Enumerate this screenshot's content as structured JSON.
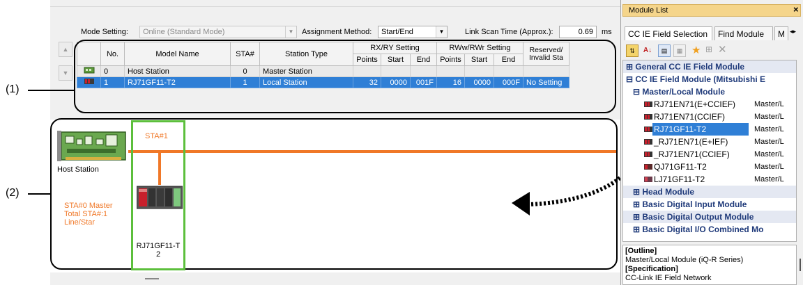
{
  "callouts": {
    "one": "(1)",
    "two": "(2)"
  },
  "toolbar": {
    "mode_label": "Mode Setting:",
    "mode_value": "Online (Standard Mode)",
    "assign_label": "Assignment Method:",
    "assign_value": "Start/End",
    "scan_label": "Link Scan Time (Approx.):",
    "scan_value": "0.69",
    "scan_unit": "ms"
  },
  "table": {
    "headers": {
      "no": "No.",
      "model": "Model Name",
      "sta": "STA#",
      "type": "Station Type",
      "rxry": "RX/RY Setting",
      "rwwr": "RWw/RWr Setting",
      "reserved": "Reserved/",
      "invalid": "Invalid Sta",
      "points": "Points",
      "start": "Start",
      "end": "End"
    },
    "rows": [
      {
        "no": "0",
        "model": "Host Station",
        "sta": "0",
        "type": "Master Station",
        "rx_points": "",
        "rx_start": "",
        "rx_end": "",
        "rw_points": "",
        "rw_start": "",
        "rw_end": "",
        "reserved": ""
      },
      {
        "no": "1",
        "model": "RJ71GF11-T2",
        "sta": "1",
        "type": "Local Station",
        "rx_points": "32",
        "rx_start": "0000",
        "rx_end": "001F",
        "rw_points": "16",
        "rw_start": "0000",
        "rw_end": "000F",
        "reserved": "No Setting"
      }
    ]
  },
  "canvas": {
    "host_label": "Host Station",
    "sta_tag": "STA#1",
    "info_line1": "STA#0  Master",
    "info_line2": "Total STA#:1",
    "info_line3": "Line/Star",
    "module_label_1": "RJ71GF11-T",
    "module_label_2": "2"
  },
  "panel": {
    "title": "Module List",
    "close": "×",
    "tabs": [
      "CC IE Field Selection",
      "Find Module",
      "M"
    ],
    "tree": {
      "cat_general": "General CC IE Field Module",
      "cat_mitsubishi": "CC IE Field Module (Mitsubishi E",
      "cat_master_local": "Master/Local Module",
      "items": [
        {
          "name": "RJ71EN71(E+CCIEF)",
          "type": "Master/L"
        },
        {
          "name": "RJ71EN71(CCIEF)",
          "type": "Master/L"
        },
        {
          "name": "RJ71GF11-T2",
          "type": "Master/L"
        },
        {
          "name": "_RJ71EN71(E+IEF)",
          "type": "Master/L"
        },
        {
          "name": "_RJ71EN71(CCIEF)",
          "type": "Master/L"
        },
        {
          "name": "QJ71GF11-T2",
          "type": "Master/L"
        },
        {
          "name": "LJ71GF11-T2",
          "type": "Master/L"
        }
      ],
      "cat_head": "Head Module",
      "cat_input": "Basic Digital Input Module",
      "cat_output": "Basic Digital Output Module",
      "cat_io": "Basic Digital I/O Combined Mo"
    },
    "outline_title": "[Outline]",
    "outline_text": "Master/Local Module (iQ-R Series)",
    "spec_title": "[Specification]",
    "spec_text": "CC-Link IE Field Network"
  },
  "colors": {
    "accent_orange": "#f07828",
    "green_frame": "#5cbf3c",
    "selection": "#2f7fd6"
  }
}
